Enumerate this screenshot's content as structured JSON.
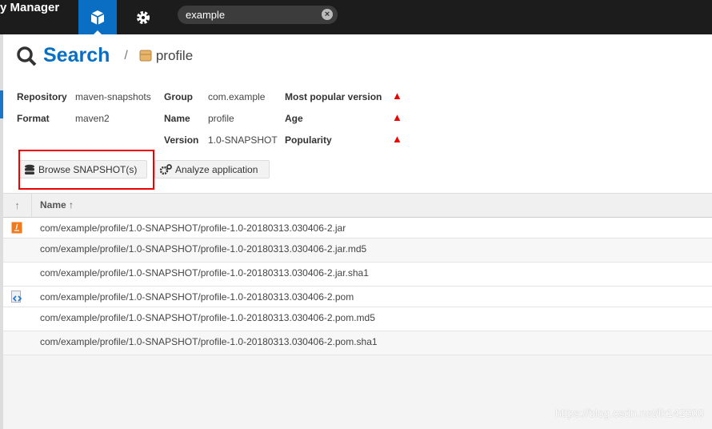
{
  "header": {
    "brand": "y Manager",
    "search_value": "example"
  },
  "page": {
    "title": "Search",
    "separator": "/",
    "crumb": "profile"
  },
  "info": {
    "repository_label": "Repository",
    "repository": "maven-snapshots",
    "format_label": "Format",
    "format": "maven2",
    "group_label": "Group",
    "group": "com.example",
    "name_label": "Name",
    "name": "profile",
    "version_label": "Version",
    "version": "1.0-SNAPSHOT",
    "popular_label": "Most popular version",
    "age_label": "Age",
    "popularity_label": "Popularity"
  },
  "buttons": {
    "browse": "Browse SNAPSHOT(s)",
    "analyze": "Analyze application"
  },
  "table": {
    "sort_icon": "↑",
    "name_header": "Name ↑",
    "rows": [
      {
        "name": "com/example/profile/1.0-SNAPSHOT/profile-1.0-20180313.030406-2.jar",
        "icon": "jar-icon"
      },
      {
        "name": "com/example/profile/1.0-SNAPSHOT/profile-1.0-20180313.030406-2.jar.md5",
        "icon": ""
      },
      {
        "name": "com/example/profile/1.0-SNAPSHOT/profile-1.0-20180313.030406-2.jar.sha1",
        "icon": ""
      },
      {
        "name": "com/example/profile/1.0-SNAPSHOT/profile-1.0-20180313.030406-2.pom",
        "icon": "xml-file-icon"
      },
      {
        "name": "com/example/profile/1.0-SNAPSHOT/profile-1.0-20180313.030406-2.pom.md5",
        "icon": ""
      },
      {
        "name": "com/example/profile/1.0-SNAPSHOT/profile-1.0-20180313.030406-2.pom.sha1",
        "icon": ""
      }
    ]
  },
  "watermark": "https://blog.csdn.net/lk142500",
  "colors": {
    "accent": "#0a6fc2",
    "warning": "#e00000",
    "highlight_box": "#e00000"
  }
}
